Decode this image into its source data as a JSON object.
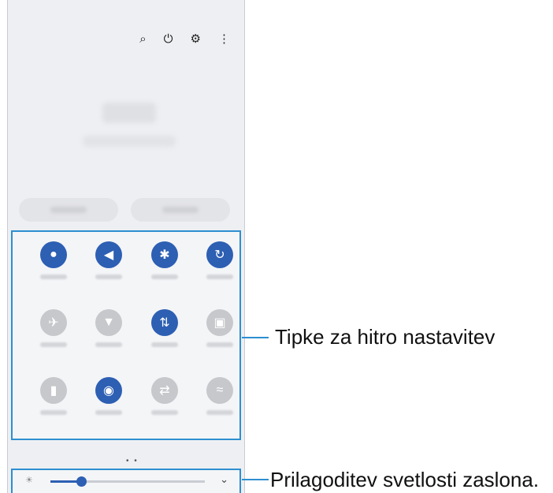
{
  "quick_panel": {
    "top_icons": [
      "search-icon",
      "power-icon",
      "gear-icon",
      "more-vert-icon"
    ],
    "tiles": [
      {
        "icon": "wifi-icon",
        "glyph": "●",
        "state": "on"
      },
      {
        "icon": "sound-icon",
        "glyph": "◀",
        "state": "on"
      },
      {
        "icon": "bluetooth-icon",
        "glyph": "✱",
        "state": "on"
      },
      {
        "icon": "auto-rotate-icon",
        "glyph": "↻",
        "state": "on"
      },
      {
        "icon": "airplane-icon",
        "glyph": "✈",
        "state": "off"
      },
      {
        "icon": "torch-icon",
        "glyph": "▼",
        "state": "off"
      },
      {
        "icon": "mobile-data-icon",
        "glyph": "⇅",
        "state": "on"
      },
      {
        "icon": "mobile-hotspot-icon",
        "glyph": "▣",
        "state": "off"
      },
      {
        "icon": "power-saving-icon",
        "glyph": "▮",
        "state": "off"
      },
      {
        "icon": "location-icon",
        "glyph": "◉",
        "state": "on"
      },
      {
        "icon": "quick-share-icon",
        "glyph": "⇄",
        "state": "off"
      },
      {
        "icon": "nearby-share-icon",
        "glyph": "≈",
        "state": "off"
      }
    ],
    "page_indicator": "• •",
    "brightness": {
      "level": 0.2,
      "icon": "sun-icon"
    },
    "accent": "#2d5fb3"
  },
  "callouts": {
    "quick_settings": "Tipke za hitro nastavitev",
    "brightness": "Prilagoditev svetlosti zaslona."
  }
}
